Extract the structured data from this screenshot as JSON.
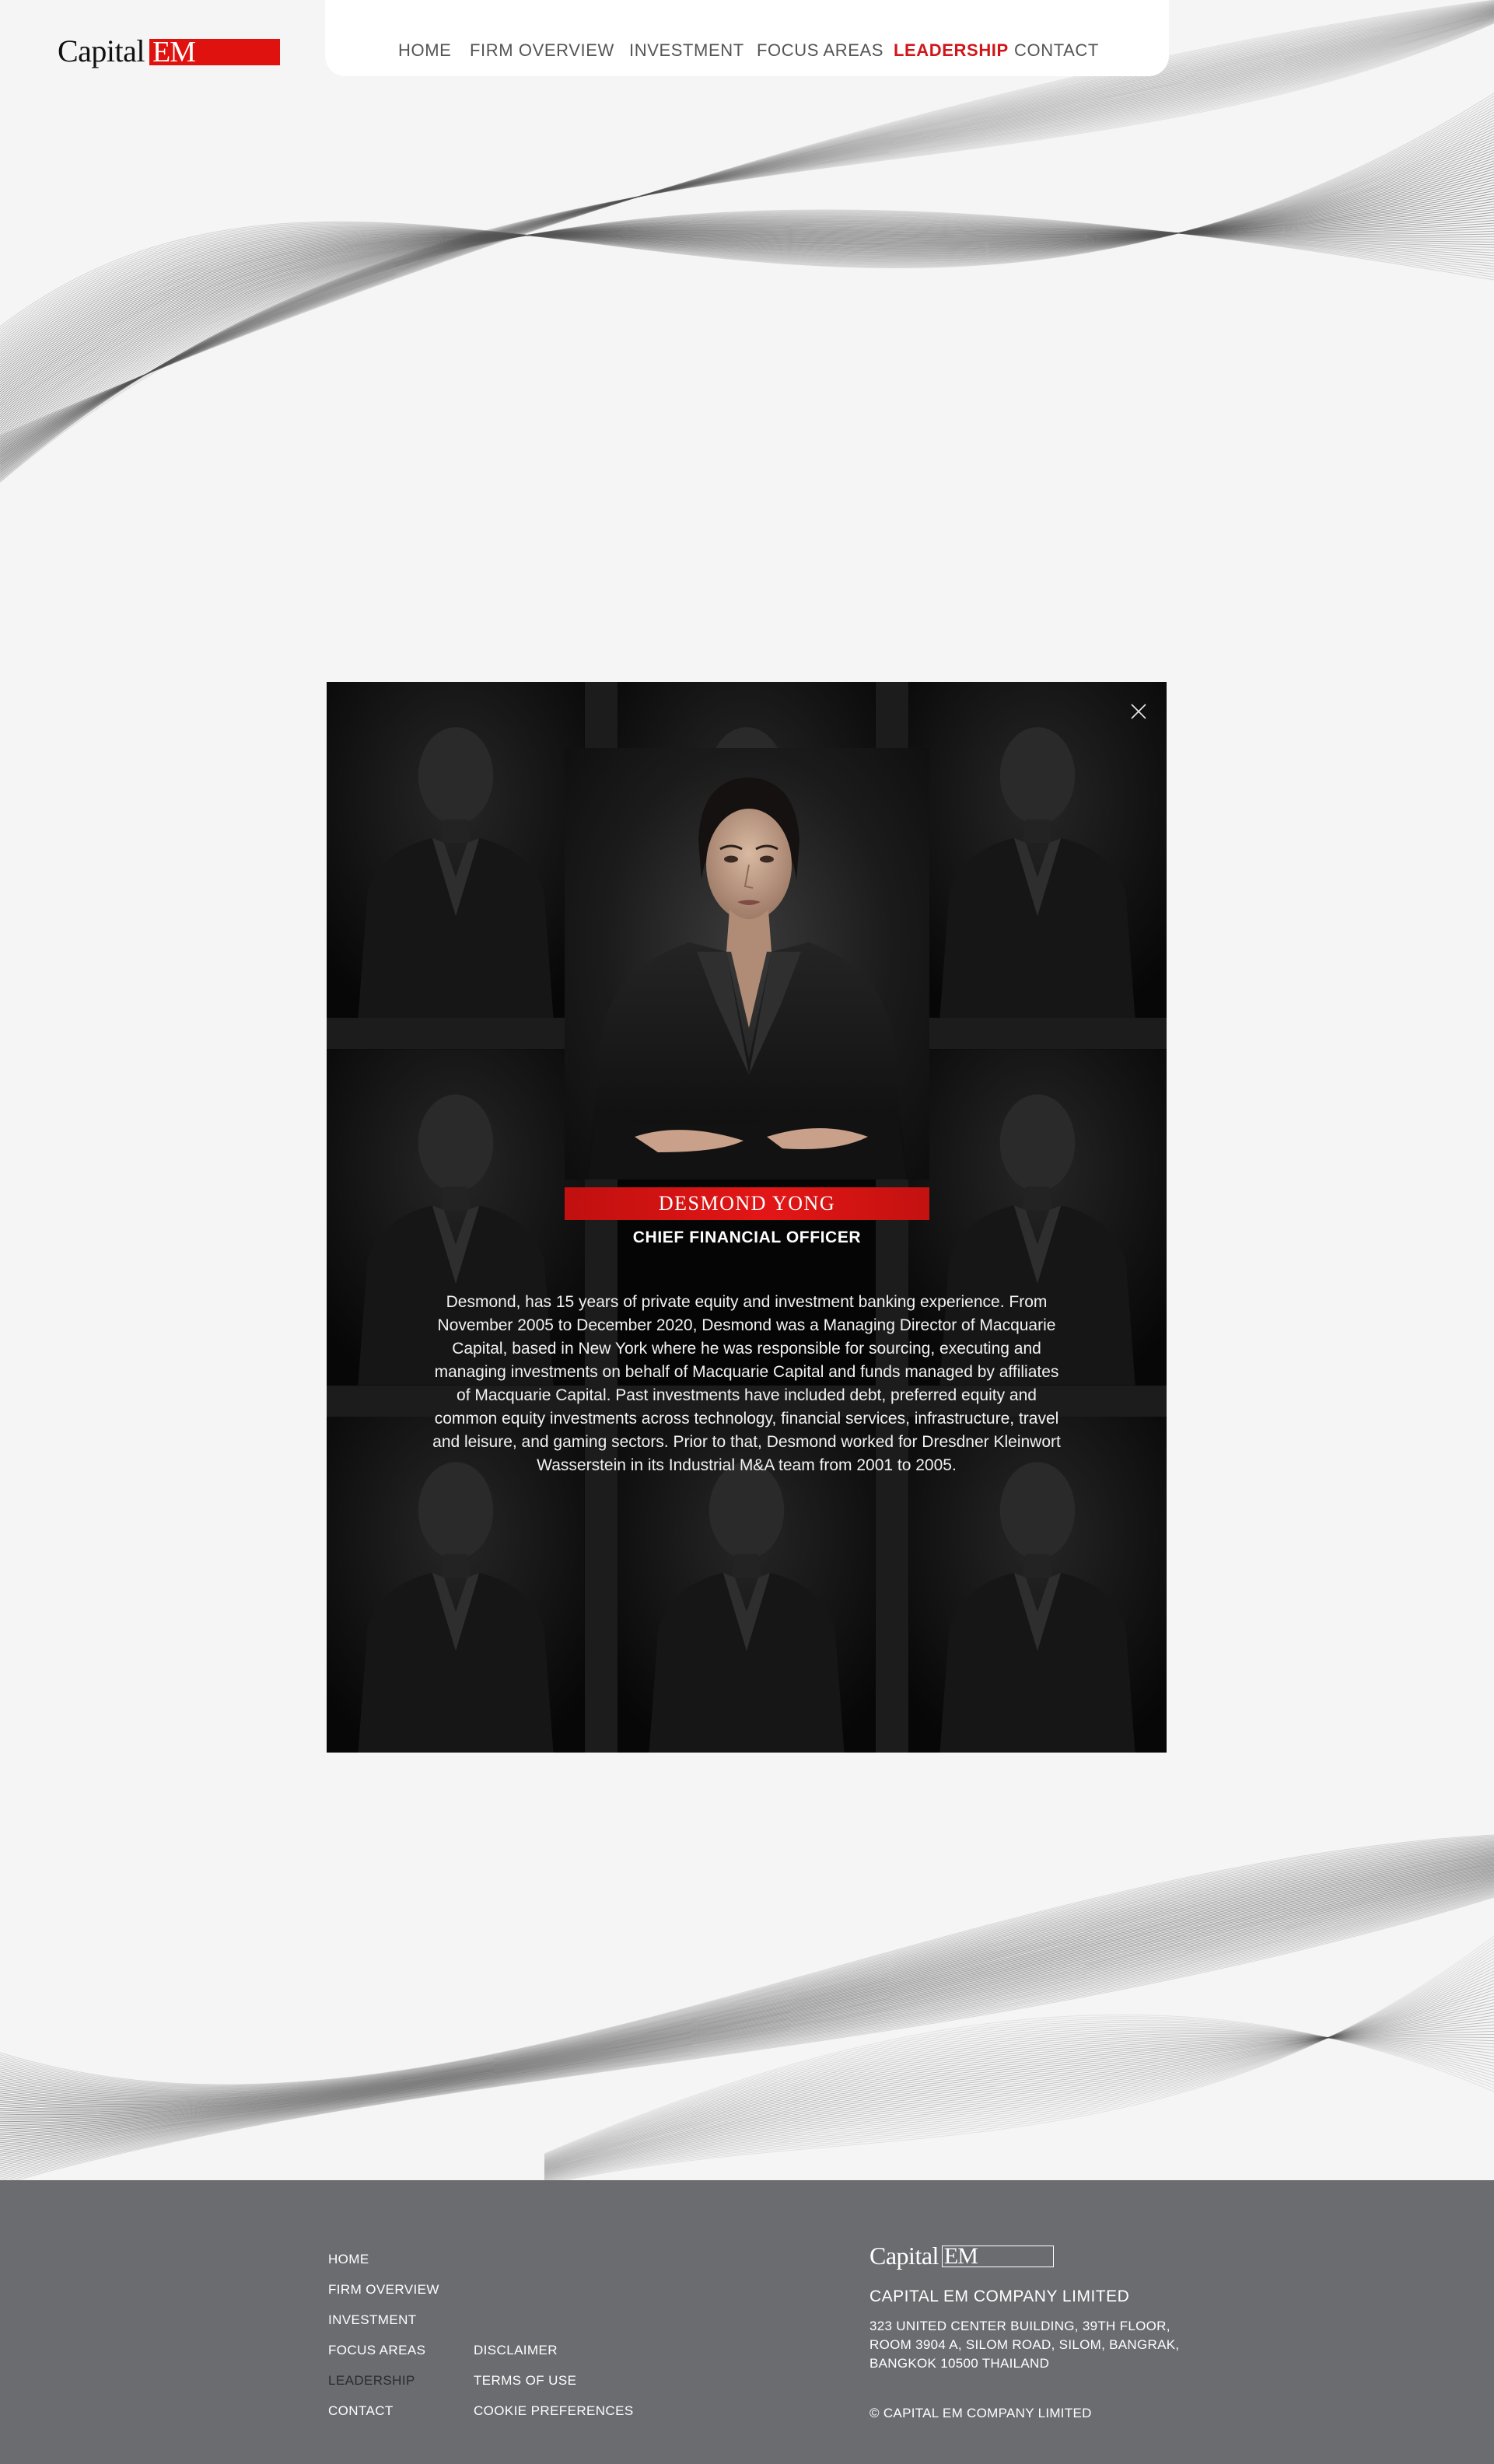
{
  "brand": {
    "logo_word": "Capital",
    "logo_em": "EM",
    "accent_color": "#e0120f"
  },
  "nav": {
    "items": [
      "HOME",
      "FIRM OVERVIEW",
      "INVESTMENT",
      "FOCUS AREAS",
      "LEADERSHIP",
      "CONTACT"
    ],
    "active": "LEADERSHIP",
    "active_color": "#d0161a"
  },
  "modal": {
    "close_icon": "close-icon",
    "name": "DESMOND YONG",
    "role": "CHIEF FINANCIAL OFFICER",
    "bio": "Desmond, has 15 years of private equity and investment banking experience. From November 2005 to December 2020, Desmond was a Managing Director of Macquarie Capital, based in New York where he was responsible for sourcing, executing and managing investments on behalf of Macquarie Capital and funds managed by affiliates of Macquarie Capital. Past investments have included debt, preferred equity and common equity investments across technology, financial services, infrastructure, travel and leisure, and gaming sectors. Prior to that, Desmond worked for Dresdner Kleinwort Wasserstein in its Industrial M&A team from 2001 to 2005."
  },
  "footer": {
    "nav_col1": [
      "HOME",
      "FIRM OVERVIEW",
      "INVESTMENT",
      "FOCUS AREAS",
      "LEADERSHIP",
      "CONTACT"
    ],
    "nav_col2": [
      "DISCLAIMER",
      "TERMS OF USE",
      "COOKIE PREFERENCES"
    ],
    "logo_word": "Capital",
    "logo_em": "EM",
    "company": "CAPITAL EM COMPANY LIMITED",
    "address_lines": [
      "323 UNITED CENTER BUILDING, 39TH FLOOR,",
      "ROOM 3904 A, SILOM ROAD, SILOM, BANGRAK,",
      "BANGKOK 10500 THAILAND"
    ],
    "copyright": "© CAPITAL EM COMPANY LIMITED",
    "background_color": "#6b6c70"
  }
}
